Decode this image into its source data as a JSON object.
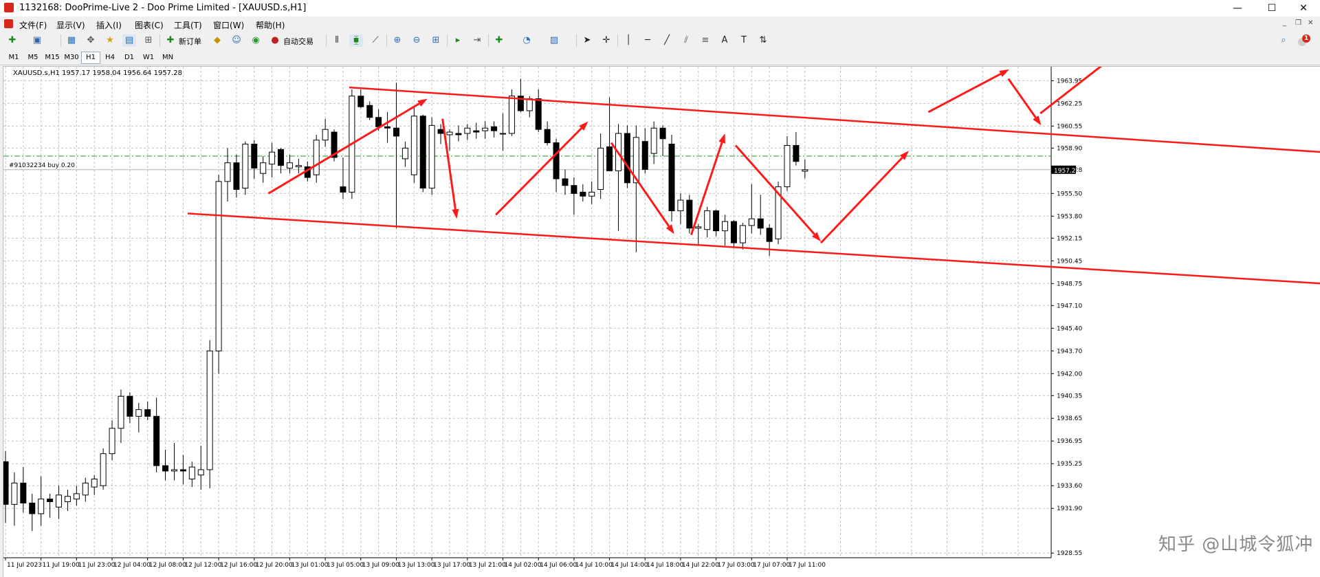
{
  "window": {
    "title": "1132168: DooPrime-Live 2 - Doo Prime Limited - [XAUUSD.s,H1]",
    "controls": [
      "—",
      "☐",
      "✕"
    ]
  },
  "menu": {
    "items": [
      "文件(F)",
      "显示(V)",
      "插入(I)",
      "图表(C)",
      "工具(T)",
      "窗口(W)",
      "帮助(H)"
    ],
    "mdi_controls": [
      "_",
      "❐",
      "✕"
    ]
  },
  "toolbar": {
    "new_order_label": "新订单",
    "auto_trade_label": "自动交易",
    "notification_badge": "1"
  },
  "timeframes": [
    "M1",
    "M5",
    "M15",
    "M30",
    "H1",
    "H4",
    "D1",
    "W1",
    "MN"
  ],
  "active_timeframe": "H1",
  "chart_header": {
    "symbol_info": "XAUUSD.s,H1  1957.17 1958.04 1956.64 1957.28"
  },
  "order_line": {
    "label": "#91032234 buy 0.20",
    "price": 1958.3
  },
  "watermark": "知乎 @山城令狐冲",
  "colors": {
    "bull_fill": "#ffffff",
    "bear_fill": "#000000",
    "candle_line": "#000000",
    "grid": "#c0c0c0",
    "annotation": "#ff1a1a",
    "order_line": "#1a9a1a",
    "price_tag_bg": "#000000"
  },
  "chart_data": {
    "type": "candlestick",
    "symbol": "XAUUSD.s",
    "timeframe": "H1",
    "ylim": [
      1928.2,
      1965.0
    ],
    "y_ticks": [
      1963.95,
      1962.25,
      1960.55,
      1958.9,
      1957.28,
      1955.5,
      1953.8,
      1952.15,
      1950.45,
      1948.75,
      1947.1,
      1945.4,
      1943.7,
      1942.0,
      1940.35,
      1938.65,
      1936.95,
      1935.25,
      1933.6,
      1931.9,
      1928.55
    ],
    "x_ticks": [
      "11 Jul 2023",
      "11 Jul 19:00",
      "11 Jul 23:00",
      "12 Jul 04:00",
      "12 Jul 08:00",
      "12 Jul 12:00",
      "12 Jul 16:00",
      "12 Jul 20:00",
      "13 Jul 01:00",
      "13 Jul 05:00",
      "13 Jul 09:00",
      "13 Jul 13:00",
      "13 Jul 17:00",
      "13 Jul 21:00",
      "14 Jul 02:00",
      "14 Jul 06:00",
      "14 Jul 10:00",
      "14 Jul 14:00",
      "14 Jul 18:00",
      "14 Jul 22:00",
      "17 Jul 03:00",
      "17 Jul 07:00",
      "17 Jul 11:00"
    ],
    "current_price": 1957.28,
    "candles": [
      {
        "o": 1935.4,
        "h": 1936.2,
        "l": 1930.8,
        "c": 1932.2
      },
      {
        "o": 1932.2,
        "h": 1934.6,
        "l": 1930.6,
        "c": 1933.8
      },
      {
        "o": 1933.8,
        "h": 1935.0,
        "l": 1931.6,
        "c": 1932.3
      },
      {
        "o": 1932.3,
        "h": 1933.0,
        "l": 1930.2,
        "c": 1931.5
      },
      {
        "o": 1931.5,
        "h": 1934.3,
        "l": 1930.6,
        "c": 1932.6
      },
      {
        "o": 1932.6,
        "h": 1933.0,
        "l": 1931.2,
        "c": 1932.4
      },
      {
        "o": 1932.0,
        "h": 1933.6,
        "l": 1931.1,
        "c": 1932.9
      },
      {
        "o": 1932.4,
        "h": 1933.3,
        "l": 1931.7,
        "c": 1932.8
      },
      {
        "o": 1932.6,
        "h": 1933.6,
        "l": 1932.1,
        "c": 1933.0
      },
      {
        "o": 1932.9,
        "h": 1934.2,
        "l": 1932.4,
        "c": 1933.8
      },
      {
        "o": 1933.5,
        "h": 1934.4,
        "l": 1932.9,
        "c": 1934.1
      },
      {
        "o": 1933.6,
        "h": 1936.4,
        "l": 1933.3,
        "c": 1936.0
      },
      {
        "o": 1936.0,
        "h": 1938.5,
        "l": 1935.5,
        "c": 1937.9
      },
      {
        "o": 1937.9,
        "h": 1940.8,
        "l": 1936.8,
        "c": 1940.3
      },
      {
        "o": 1940.3,
        "h": 1940.6,
        "l": 1938.3,
        "c": 1938.8
      },
      {
        "o": 1938.8,
        "h": 1939.8,
        "l": 1937.6,
        "c": 1939.3
      },
      {
        "o": 1939.3,
        "h": 1939.9,
        "l": 1938.5,
        "c": 1938.8
      },
      {
        "o": 1938.8,
        "h": 1940.2,
        "l": 1934.6,
        "c": 1935.1
      },
      {
        "o": 1935.1,
        "h": 1936.3,
        "l": 1934.0,
        "c": 1934.7
      },
      {
        "o": 1934.7,
        "h": 1936.8,
        "l": 1934.0,
        "c": 1934.8
      },
      {
        "o": 1934.8,
        "h": 1935.9,
        "l": 1933.7,
        "c": 1934.7
      },
      {
        "o": 1934.1,
        "h": 1935.4,
        "l": 1933.5,
        "c": 1935.0
      },
      {
        "o": 1934.4,
        "h": 1936.6,
        "l": 1933.3,
        "c": 1934.8
      },
      {
        "o": 1934.8,
        "h": 1944.5,
        "l": 1933.4,
        "c": 1943.7
      },
      {
        "o": 1943.7,
        "h": 1956.9,
        "l": 1942.0,
        "c": 1956.4
      },
      {
        "o": 1956.4,
        "h": 1958.9,
        "l": 1954.9,
        "c": 1957.8
      },
      {
        "o": 1957.8,
        "h": 1958.4,
        "l": 1955.2,
        "c": 1955.8
      },
      {
        "o": 1955.9,
        "h": 1959.4,
        "l": 1955.4,
        "c": 1959.2
      },
      {
        "o": 1959.2,
        "h": 1959.5,
        "l": 1956.6,
        "c": 1957.4
      },
      {
        "o": 1957.0,
        "h": 1958.3,
        "l": 1956.3,
        "c": 1957.8
      },
      {
        "o": 1957.7,
        "h": 1959.3,
        "l": 1956.7,
        "c": 1958.6
      },
      {
        "o": 1958.8,
        "h": 1958.9,
        "l": 1957.0,
        "c": 1957.6
      },
      {
        "o": 1957.4,
        "h": 1958.4,
        "l": 1957.0,
        "c": 1957.8
      },
      {
        "o": 1957.5,
        "h": 1958.1,
        "l": 1957.0,
        "c": 1957.6
      },
      {
        "o": 1957.5,
        "h": 1957.9,
        "l": 1956.4,
        "c": 1956.7
      },
      {
        "o": 1956.9,
        "h": 1959.9,
        "l": 1956.3,
        "c": 1959.5
      },
      {
        "o": 1959.5,
        "h": 1961.1,
        "l": 1959.0,
        "c": 1960.3
      },
      {
        "o": 1960.1,
        "h": 1960.3,
        "l": 1957.9,
        "c": 1958.2
      },
      {
        "o": 1956.0,
        "h": 1958.2,
        "l": 1955.1,
        "c": 1955.6
      },
      {
        "o": 1955.6,
        "h": 1963.3,
        "l": 1955.1,
        "c": 1962.8
      },
      {
        "o": 1962.8,
        "h": 1963.3,
        "l": 1961.9,
        "c": 1962.0
      },
      {
        "o": 1962.1,
        "h": 1962.4,
        "l": 1961.0,
        "c": 1961.2
      },
      {
        "o": 1961.2,
        "h": 1961.8,
        "l": 1960.2,
        "c": 1960.5
      },
      {
        "o": 1960.5,
        "h": 1961.6,
        "l": 1959.3,
        "c": 1960.4
      },
      {
        "o": 1960.4,
        "h": 1963.8,
        "l": 1952.9,
        "c": 1959.8
      },
      {
        "o": 1958.1,
        "h": 1959.4,
        "l": 1957.5,
        "c": 1958.9
      },
      {
        "o": 1956.9,
        "h": 1962.0,
        "l": 1956.3,
        "c": 1961.3
      },
      {
        "o": 1961.3,
        "h": 1961.4,
        "l": 1955.6,
        "c": 1955.9
      },
      {
        "o": 1955.9,
        "h": 1961.2,
        "l": 1955.4,
        "c": 1960.6
      },
      {
        "o": 1960.3,
        "h": 1960.7,
        "l": 1959.2,
        "c": 1960.0
      },
      {
        "o": 1959.9,
        "h": 1960.3,
        "l": 1958.7,
        "c": 1960.1
      },
      {
        "o": 1960.0,
        "h": 1960.6,
        "l": 1959.4,
        "c": 1959.9
      },
      {
        "o": 1960.0,
        "h": 1960.7,
        "l": 1959.5,
        "c": 1960.4
      },
      {
        "o": 1960.2,
        "h": 1960.8,
        "l": 1959.6,
        "c": 1960.1
      },
      {
        "o": 1960.2,
        "h": 1960.9,
        "l": 1959.6,
        "c": 1960.4
      },
      {
        "o": 1960.5,
        "h": 1960.9,
        "l": 1959.7,
        "c": 1960.2
      },
      {
        "o": 1960.0,
        "h": 1961.5,
        "l": 1958.7,
        "c": 1960.0
      },
      {
        "o": 1960.0,
        "h": 1963.3,
        "l": 1959.8,
        "c": 1962.8
      },
      {
        "o": 1962.8,
        "h": 1964.1,
        "l": 1961.6,
        "c": 1961.7
      },
      {
        "o": 1961.7,
        "h": 1962.8,
        "l": 1961.2,
        "c": 1962.6
      },
      {
        "o": 1962.6,
        "h": 1963.3,
        "l": 1960.1,
        "c": 1960.3
      },
      {
        "o": 1960.3,
        "h": 1960.9,
        "l": 1959.1,
        "c": 1959.3
      },
      {
        "o": 1959.3,
        "h": 1959.6,
        "l": 1955.6,
        "c": 1956.6
      },
      {
        "o": 1956.6,
        "h": 1957.3,
        "l": 1955.4,
        "c": 1956.1
      },
      {
        "o": 1956.1,
        "h": 1956.7,
        "l": 1953.9,
        "c": 1955.5
      },
      {
        "o": 1955.6,
        "h": 1956.2,
        "l": 1954.9,
        "c": 1955.3
      },
      {
        "o": 1955.3,
        "h": 1956.4,
        "l": 1954.7,
        "c": 1955.6
      },
      {
        "o": 1955.8,
        "h": 1960.0,
        "l": 1955.1,
        "c": 1958.9
      },
      {
        "o": 1959.0,
        "h": 1962.7,
        "l": 1957.7,
        "c": 1957.2
      },
      {
        "o": 1957.2,
        "h": 1960.7,
        "l": 1952.7,
        "c": 1960.0
      },
      {
        "o": 1960.0,
        "h": 1960.6,
        "l": 1955.9,
        "c": 1956.3
      },
      {
        "o": 1956.3,
        "h": 1960.6,
        "l": 1951.1,
        "c": 1959.7
      },
      {
        "o": 1959.4,
        "h": 1960.4,
        "l": 1957.0,
        "c": 1957.3
      },
      {
        "o": 1958.5,
        "h": 1960.9,
        "l": 1957.7,
        "c": 1960.4
      },
      {
        "o": 1960.4,
        "h": 1960.6,
        "l": 1958.3,
        "c": 1959.6
      },
      {
        "o": 1959.2,
        "h": 1959.9,
        "l": 1953.4,
        "c": 1954.2
      },
      {
        "o": 1954.2,
        "h": 1955.5,
        "l": 1953.2,
        "c": 1955.0
      },
      {
        "o": 1955.0,
        "h": 1955.4,
        "l": 1952.5,
        "c": 1952.9
      },
      {
        "o": 1952.9,
        "h": 1953.2,
        "l": 1951.6,
        "c": 1953.0
      },
      {
        "o": 1952.8,
        "h": 1954.5,
        "l": 1952.2,
        "c": 1954.2
      },
      {
        "o": 1954.2,
        "h": 1954.3,
        "l": 1952.3,
        "c": 1952.7
      },
      {
        "o": 1952.7,
        "h": 1953.9,
        "l": 1951.6,
        "c": 1953.4
      },
      {
        "o": 1953.4,
        "h": 1953.5,
        "l": 1951.4,
        "c": 1951.8
      },
      {
        "o": 1951.8,
        "h": 1953.3,
        "l": 1951.3,
        "c": 1953.1
      },
      {
        "o": 1953.1,
        "h": 1956.2,
        "l": 1952.5,
        "c": 1953.6
      },
      {
        "o": 1953.6,
        "h": 1955.4,
        "l": 1952.4,
        "c": 1952.9
      },
      {
        "o": 1952.9,
        "h": 1953.2,
        "l": 1950.8,
        "c": 1951.9
      },
      {
        "o": 1952.1,
        "h": 1956.4,
        "l": 1951.7,
        "c": 1956.0
      },
      {
        "o": 1956.0,
        "h": 1959.8,
        "l": 1955.7,
        "c": 1959.1
      },
      {
        "o": 1959.1,
        "h": 1960.1,
        "l": 1957.6,
        "c": 1957.9
      },
      {
        "o": 1957.17,
        "h": 1958.04,
        "l": 1956.64,
        "c": 1957.28
      }
    ]
  },
  "annotations": {
    "channel_upper": {
      "from": {
        "bar": 38.7,
        "price": 1963.45
      },
      "to": {
        "bar": 148.2,
        "price": 1958.6
      }
    },
    "channel_lower": {
      "from": {
        "bar": 20.5,
        "price": 1954.0
      },
      "to": {
        "bar": 148.2,
        "price": 1948.75
      }
    },
    "arrows": [
      {
        "from": {
          "bar": 29.6,
          "price": 1955.5
        },
        "to": {
          "bar": 47.5,
          "price": 1962.6
        }
      },
      {
        "from": {
          "bar": 49.2,
          "price": 1961.1
        },
        "to": {
          "bar": 50.8,
          "price": 1953.6
        }
      },
      {
        "from": {
          "bar": 55.2,
          "price": 1953.9
        },
        "to": {
          "bar": 65.6,
          "price": 1960.9
        }
      },
      {
        "from": {
          "bar": 68.2,
          "price": 1959.3
        },
        "to": {
          "bar": 75.3,
          "price": 1952.45
        }
      },
      {
        "from": {
          "bar": 77.2,
          "price": 1952.4
        },
        "to": {
          "bar": 81.0,
          "price": 1960.0
        }
      },
      {
        "from": {
          "bar": 82.2,
          "price": 1959.1
        },
        "to": {
          "bar": 91.8,
          "price": 1951.9
        }
      },
      {
        "from": {
          "bar": 91.8,
          "price": 1951.8
        },
        "to": {
          "bar": 101.7,
          "price": 1958.7
        }
      },
      {
        "from": {
          "bar": 103.9,
          "price": 1961.6
        },
        "to": {
          "bar": 113.0,
          "price": 1964.8
        }
      },
      {
        "from": {
          "bar": 112.9,
          "price": 1964.1
        },
        "to": {
          "bar": 116.6,
          "price": 1960.6
        }
      },
      {
        "from": {
          "bar": 116.5,
          "price": 1961.5
        },
        "to": {
          "bar": 125.2,
          "price": 1966.0
        }
      }
    ]
  }
}
